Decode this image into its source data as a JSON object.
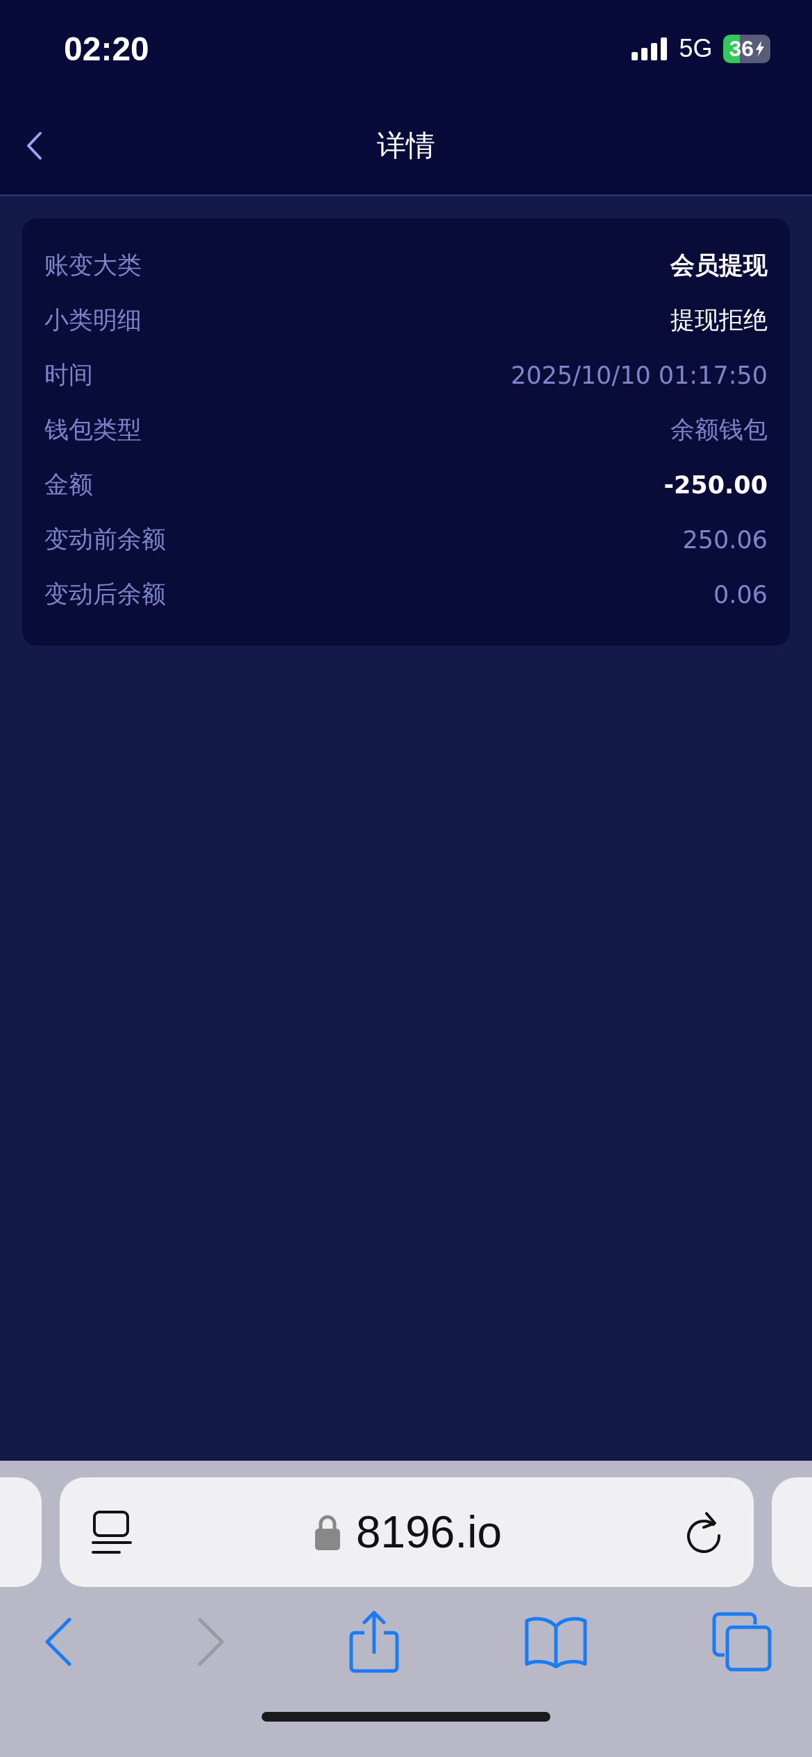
{
  "status_bar": {
    "time": "02:20",
    "network": "5G",
    "battery": "36"
  },
  "nav": {
    "title": "详情"
  },
  "details": [
    {
      "label": "账变大类",
      "value": "会员提现",
      "kind": "bold"
    },
    {
      "label": "小类明细",
      "value": "提现拒绝",
      "kind": "plain"
    },
    {
      "label": "时间",
      "value": "2025/10/10 01:17:50",
      "kind": "muted"
    },
    {
      "label": "钱包类型",
      "value": "余额钱包",
      "kind": "muted"
    },
    {
      "label": "金额",
      "value": "-250.00",
      "kind": "bold"
    },
    {
      "label": "变动前余额",
      "value": "250.06",
      "kind": "muted"
    },
    {
      "label": "变动后余额",
      "value": "0.06",
      "kind": "muted"
    }
  ],
  "browser": {
    "url": "8196.io",
    "back_disabled": false,
    "forward_disabled": true
  }
}
